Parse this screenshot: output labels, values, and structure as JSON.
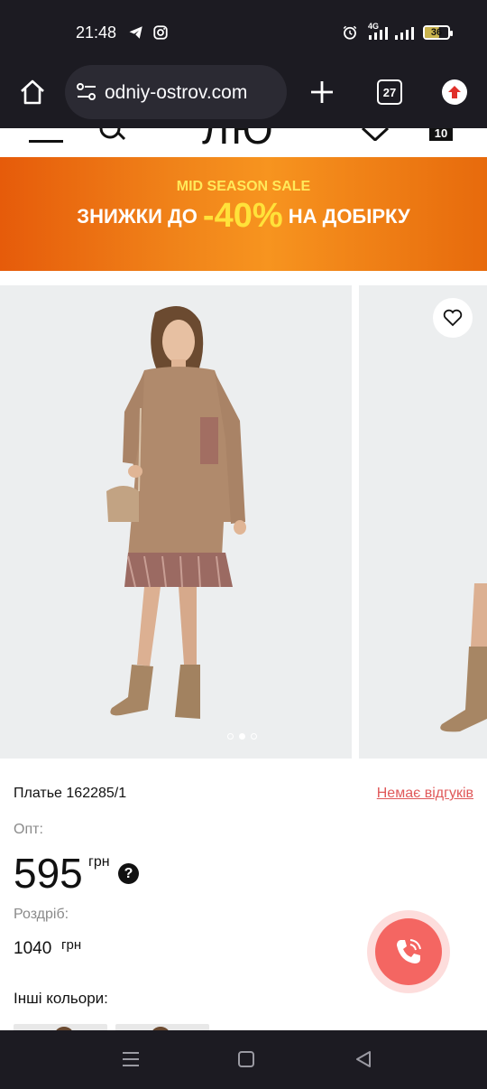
{
  "status_bar": {
    "time": "21:48",
    "battery": "36",
    "network": "4G"
  },
  "browser": {
    "url": "odniy-ostrov.com",
    "tab_count": "27"
  },
  "site_header": {
    "logo_partial": "ЛЮ",
    "cart_count": "10"
  },
  "banner": {
    "small": "MID SEASON SALE",
    "big_prefix": "ЗНИЖКИ ДО ",
    "big_pct": "-40%",
    "big_suffix": " НА ДОБІРКУ",
    "colors": {
      "orange": "#f08219",
      "yellow": "#ffe23a"
    }
  },
  "gallery": {
    "dot_count": 3,
    "active_dot": 1
  },
  "product": {
    "name": "Платье 162285/1",
    "reviews_link": "Немає відгуків",
    "wholesale_label": "Опт:",
    "wholesale_price": "595",
    "currency": "грн",
    "help_icon": "?",
    "retail_label": "Роздріб:",
    "retail_price": "1040",
    "other_colors_label": "Інші кольори:"
  },
  "accent": "#f46662"
}
